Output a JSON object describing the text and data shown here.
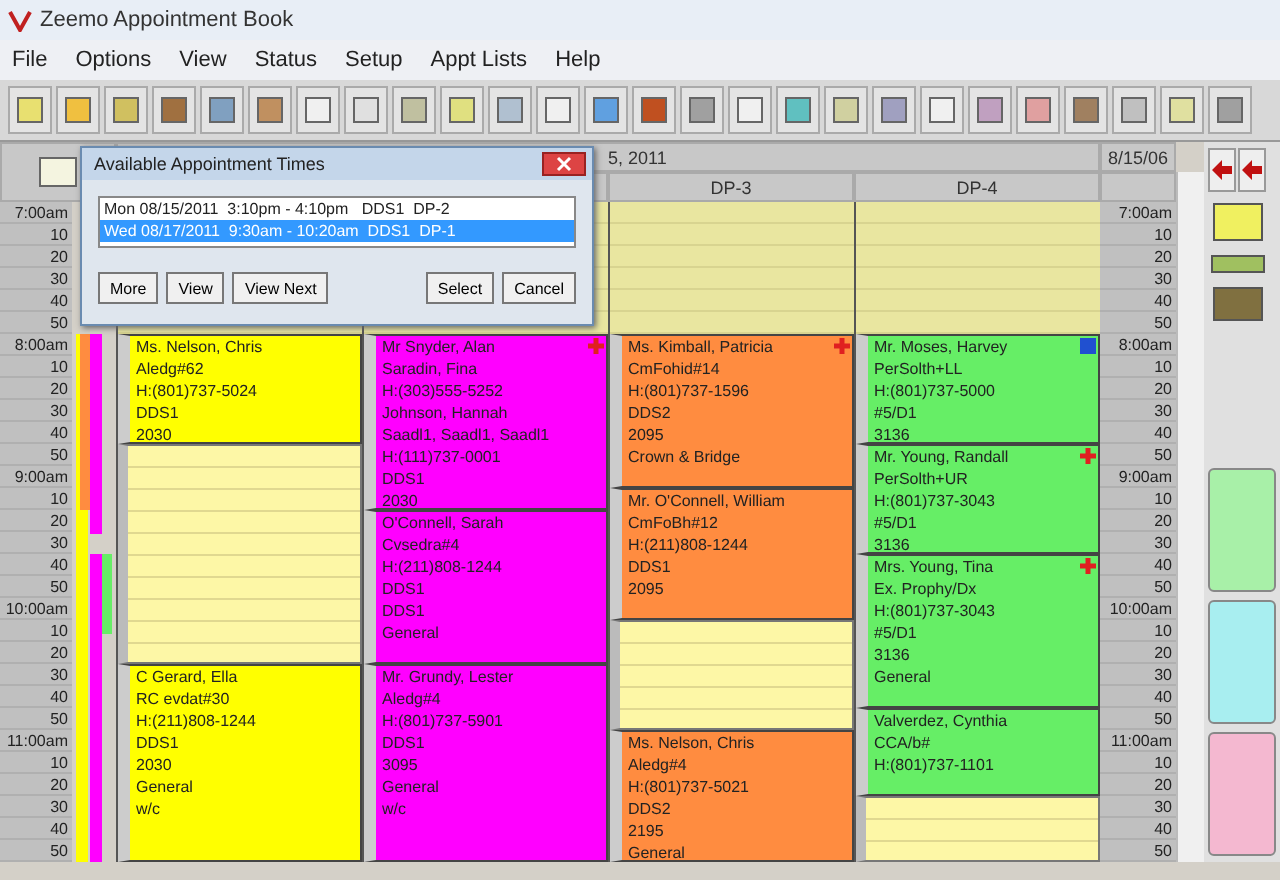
{
  "window": {
    "title": "Zeemo Appointment Book"
  },
  "menu": [
    "File",
    "Options",
    "View",
    "Status",
    "Setup",
    "Appt Lists",
    "Help"
  ],
  "header": {
    "date": "5, 2011",
    "right_date": "8/15/06"
  },
  "columns": [
    {
      "blocks": [
        {
          "kind": "closed"
        },
        {
          "kind": "appointment",
          "color": "#ffff00",
          "alert": false,
          "info": false,
          "lines": [
            "Ms. Nelson, Chris",
            "Aledg#62",
            "H:(801)737-5024",
            "DDS1",
            "2030"
          ]
        },
        {
          "kind": "open"
        },
        {
          "kind": "appointment",
          "color": "#ffff00",
          "alert": false,
          "info": false,
          "lines": [
            "C Gerard, Ella",
            "RC evdat#30",
            "H:(211)808-1244",
            "DDS1",
            "2030",
            "General",
            "w/c"
          ]
        }
      ]
    },
    {
      "blocks": [
        {
          "kind": "closed"
        },
        {
          "kind": "appointment",
          "color": "#ff00ff",
          "alert": true,
          "info": false,
          "lines": [
            "Mr Snyder, Alan",
            "Saradin, Fina",
            "H:(303)555-5252",
            "Johnson, Hannah",
            "Saadl1, Saadl1, Saadl1",
            "H:(111)737-0001",
            "DDS1",
            "2030"
          ]
        },
        {
          "kind": "appointment",
          "color": "#ff00ff",
          "alert": false,
          "info": false,
          "lines": [
            "O'Connell, Sarah",
            "Cvsedra#4",
            "H:(211)808-1244",
            "DDS1",
            "DDS1",
            "General"
          ]
        },
        {
          "kind": "appointment",
          "color": "#ff00ff",
          "alert": false,
          "info": false,
          "lines": [
            "Mr. Grundy, Lester",
            "Aledg#4",
            "H:(801)737-5901",
            "DDS1",
            "3095",
            "General",
            "w/c"
          ]
        }
      ]
    },
    {
      "header": "DP-3",
      "blocks": [
        {
          "kind": "closed"
        },
        {
          "kind": "appointment",
          "color": "#ff8c40",
          "alert": true,
          "info": false,
          "lines": [
            "Ms. Kimball, Patricia",
            "CmFohid#14",
            "H:(801)737-1596",
            "DDS2",
            "2095",
            "Crown & Bridge"
          ]
        },
        {
          "kind": "appointment",
          "color": "#ff8c40",
          "alert": false,
          "info": false,
          "lines": [
            "Mr. O'Connell, William",
            "CmFoBh#12",
            "H:(211)808-1244",
            "DDS1",
            "2095"
          ]
        },
        {
          "kind": "open"
        },
        {
          "kind": "appointment",
          "color": "#ff8c40",
          "alert": false,
          "info": false,
          "lines": [
            "Ms. Nelson, Chris",
            "Aledg#4",
            "H:(801)737-5021",
            "DDS2",
            "2195",
            "General"
          ]
        }
      ]
    },
    {
      "header": "DP-4",
      "blocks": [
        {
          "kind": "closed"
        },
        {
          "kind": "appointment",
          "color": "#66ee66",
          "alert": false,
          "info": true,
          "lines": [
            "Mr. Moses, Harvey",
            "PerSolth+LL",
            "H:(801)737-5000",
            "#5/D1",
            "3136"
          ]
        },
        {
          "kind": "appointment",
          "color": "#66ee66",
          "alert": true,
          "info": false,
          "lines": [
            "Mr. Young, Randall",
            "PerSolth+UR",
            "H:(801)737-3043",
            "#5/D1",
            "3136"
          ]
        },
        {
          "kind": "appointment",
          "color": "#66ee66",
          "alert": true,
          "info": false,
          "lines": [
            "Mrs. Young, Tina",
            "Ex. Prophy/Dx",
            "H:(801)737-3043",
            "#5/D1",
            "3136",
            "General"
          ]
        },
        {
          "kind": "appointment",
          "color": "#66ee66",
          "alert": false,
          "info": false,
          "lines": [
            "Valverdez, Cynthia",
            "CCA/b#",
            "H:(801)737-1101"
          ]
        },
        {
          "kind": "open"
        }
      ]
    }
  ],
  "time_labels": [
    "7:00am",
    "10",
    "20",
    "30",
    "40",
    "50",
    "8:00am",
    "10",
    "20",
    "30",
    "40",
    "50",
    "9:00am",
    "10",
    "20",
    "30",
    "40",
    "50",
    "10:00am",
    "10",
    "20",
    "30",
    "40",
    "50",
    "11:00am",
    "10",
    "20",
    "30",
    "40",
    "50"
  ],
  "right_time_labels": [
    "7:00am",
    "10",
    "20",
    "30",
    "40",
    "50",
    "8:00am",
    "10",
    "20",
    "30",
    "40",
    "50",
    "9:00am",
    "10",
    "20",
    "30",
    "40",
    "50",
    "10:00am",
    "10",
    "20",
    "30",
    "40",
    "50",
    "11:00am",
    "10",
    "20",
    "30",
    "40",
    "50"
  ],
  "side_tabs": [
    {
      "color": "#a8f0a8"
    },
    {
      "color": "#a8eef0"
    },
    {
      "color": "#f4b8d0"
    }
  ],
  "dialog": {
    "title": "Available Appointment Times",
    "rows": [
      {
        "text": "Mon 08/15/2011  3:10pm - 4:10pm   DDS1  DP-2",
        "selected": false
      },
      {
        "text": "Wed 08/17/2011  9:30am - 10:20am  DDS1  DP-1",
        "selected": true
      }
    ],
    "buttons": [
      "More",
      "View",
      "View Next",
      "Select",
      "Cancel"
    ]
  }
}
